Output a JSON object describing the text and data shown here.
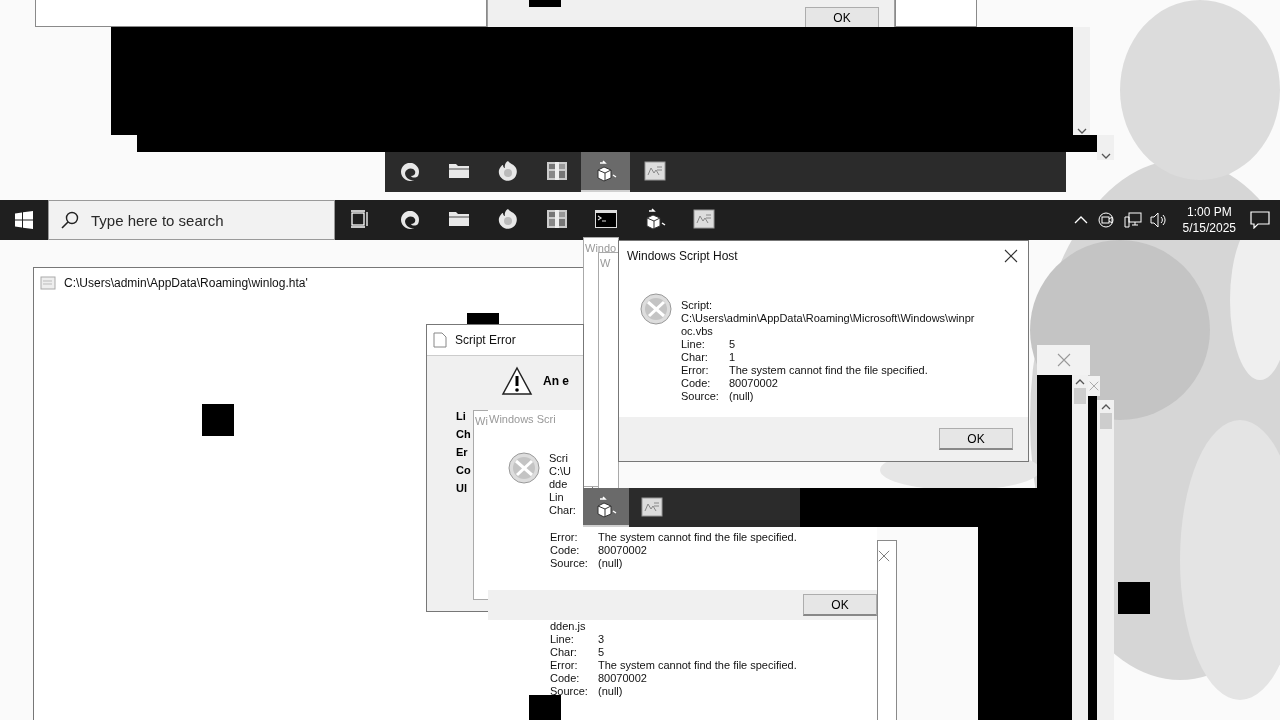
{
  "top_ghost": {
    "ok_button": "OK",
    "taskbar": [
      {
        "kind": "browser",
        "selected": false
      },
      {
        "kind": "folder",
        "selected": false
      },
      {
        "kind": "fox",
        "selected": false
      },
      {
        "kind": "archive",
        "selected": false
      },
      {
        "kind": "cube",
        "selected": true
      },
      {
        "kind": "document",
        "selected": false
      }
    ]
  },
  "taskbar": {
    "search_placeholder": "Type here to search",
    "apps": [
      {
        "kind": "browser",
        "selected": false
      },
      {
        "kind": "folder",
        "selected": false
      },
      {
        "kind": "fox",
        "selected": false
      },
      {
        "kind": "archive",
        "selected": false
      },
      {
        "kind": "terminal",
        "selected": false
      },
      {
        "kind": "cube",
        "selected": false
      },
      {
        "kind": "document",
        "selected": false
      }
    ],
    "time": "1:00 PM",
    "date": "5/15/2025"
  },
  "hta_window": {
    "title": "C:\\Users\\admin\\AppData\\Roaming\\winlog.hta'"
  },
  "ghost_titles": {
    "left": "Windo",
    "inner": "W",
    "rear": "Wi"
  },
  "script_error": {
    "title": "Script Error",
    "message": "An e",
    "labels": [
      "Li",
      "Ch",
      "Er",
      "Co",
      "Ul"
    ]
  },
  "rear_dialog": {
    "title": "Windows Scri",
    "clipped_lines": [
      "Scri",
      "C:\\U",
      "dde",
      "Lin",
      "Char:"
    ],
    "rows": [
      {
        "label": "Error:",
        "value": "The system cannot find the file specified."
      },
      {
        "label": "Code:",
        "value": "80070002"
      },
      {
        "label": "Source:",
        "value": "(null)"
      }
    ],
    "ok_button": "OK",
    "continued_line": "dden.js",
    "continued_rows": [
      {
        "label": "Line:",
        "value": "3"
      },
      {
        "label": "Char:",
        "value": "5"
      },
      {
        "label": "Error:",
        "value": "The system cannot find the file specified."
      },
      {
        "label": "Code:",
        "value": "80070002"
      },
      {
        "label": "Source:",
        "value": "(null)"
      }
    ]
  },
  "main_dialog": {
    "title": "Windows Script Host",
    "script_lines": [
      "Script:",
      "C:\\Users\\admin\\AppData\\Roaming\\Microsoft\\Windows\\winpr",
      "oc.vbs"
    ],
    "rows": [
      {
        "label": "Line:",
        "value": "5"
      },
      {
        "label": "Char:",
        "value": "1"
      },
      {
        "label": "Error:",
        "value": "The system cannot find the file specified."
      },
      {
        "label": "Code:",
        "value": "80070002"
      },
      {
        "label": "Source:",
        "value": "(null)"
      }
    ],
    "ok_button": "OK"
  },
  "lower_ghost_taskbar": [
    {
      "kind": "cube",
      "selected": true
    },
    {
      "kind": "document",
      "selected": false
    }
  ]
}
